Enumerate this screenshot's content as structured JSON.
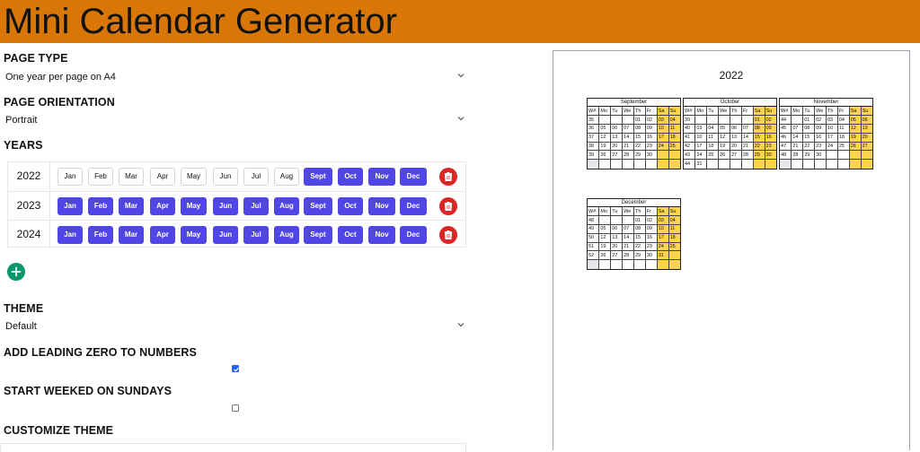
{
  "header": {
    "title": "Mini Calendar Generator"
  },
  "page_type": {
    "label": "PAGE TYPE",
    "value": "One year per page on A4"
  },
  "page_orientation": {
    "label": "PAGE ORIENTATION",
    "value": "Portrait"
  },
  "years": {
    "label": "YEARS",
    "rows": [
      {
        "year": "2022",
        "months": [
          {
            "label": "Jan",
            "on": false
          },
          {
            "label": "Feb",
            "on": false
          },
          {
            "label": "Mar",
            "on": false
          },
          {
            "label": "Apr",
            "on": false
          },
          {
            "label": "May",
            "on": false
          },
          {
            "label": "Jun",
            "on": false
          },
          {
            "label": "Jul",
            "on": false
          },
          {
            "label": "Aug",
            "on": false
          },
          {
            "label": "Sept",
            "on": true
          },
          {
            "label": "Oct",
            "on": true
          },
          {
            "label": "Nov",
            "on": true
          },
          {
            "label": "Dec",
            "on": true
          }
        ]
      },
      {
        "year": "2023",
        "months": [
          {
            "label": "Jan",
            "on": true
          },
          {
            "label": "Feb",
            "on": true
          },
          {
            "label": "Mar",
            "on": true
          },
          {
            "label": "Apr",
            "on": true
          },
          {
            "label": "May",
            "on": true
          },
          {
            "label": "Jun",
            "on": true
          },
          {
            "label": "Jul",
            "on": true
          },
          {
            "label": "Aug",
            "on": true
          },
          {
            "label": "Sept",
            "on": true
          },
          {
            "label": "Oct",
            "on": true
          },
          {
            "label": "Nov",
            "on": true
          },
          {
            "label": "Dec",
            "on": true
          }
        ]
      },
      {
        "year": "2024",
        "months": [
          {
            "label": "Jan",
            "on": true
          },
          {
            "label": "Feb",
            "on": true
          },
          {
            "label": "Mar",
            "on": true
          },
          {
            "label": "Apr",
            "on": true
          },
          {
            "label": "May",
            "on": true
          },
          {
            "label": "Jun",
            "on": true
          },
          {
            "label": "Jul",
            "on": true
          },
          {
            "label": "Aug",
            "on": true
          },
          {
            "label": "Sept",
            "on": true
          },
          {
            "label": "Oct",
            "on": true
          },
          {
            "label": "Nov",
            "on": true
          },
          {
            "label": "Dec",
            "on": true
          }
        ]
      }
    ]
  },
  "theme": {
    "label": "THEME",
    "value": "Default"
  },
  "leading_zero": {
    "label": "ADD LEADING ZERO TO NUMBERS",
    "checked": true
  },
  "start_sunday": {
    "label": "START WEEKED ON SUNDAYS",
    "checked": false
  },
  "customize_theme": {
    "label": "CUSTOMIZE THEME"
  },
  "preview": {
    "year": "2022",
    "header": [
      "W#",
      "Mo",
      "Tu",
      "We",
      "Th",
      "Fr",
      "Sa",
      "Su"
    ],
    "calendars": [
      {
        "name": "September",
        "weeks": [
          [
            "35",
            "",
            "",
            "",
            "01",
            "02",
            "03",
            "04"
          ],
          [
            "36",
            "05",
            "06",
            "07",
            "08",
            "09",
            "10",
            "11"
          ],
          [
            "37",
            "12",
            "13",
            "14",
            "15",
            "16",
            "17",
            "18"
          ],
          [
            "38",
            "19",
            "20",
            "21",
            "22",
            "23",
            "24",
            "25"
          ],
          [
            "39",
            "26",
            "27",
            "28",
            "29",
            "30",
            "",
            ""
          ],
          [
            "",
            "",
            "",
            "",
            "",
            "",
            "",
            ""
          ]
        ]
      },
      {
        "name": "October",
        "weeks": [
          [
            "39",
            "",
            "",
            "",
            "",
            "",
            "01",
            "02"
          ],
          [
            "40",
            "03",
            "04",
            "05",
            "06",
            "07",
            "08",
            "09"
          ],
          [
            "41",
            "10",
            "11",
            "12",
            "13",
            "14",
            "15",
            "16"
          ],
          [
            "42",
            "17",
            "18",
            "19",
            "20",
            "21",
            "22",
            "23"
          ],
          [
            "43",
            "24",
            "25",
            "26",
            "27",
            "28",
            "29",
            "30"
          ],
          [
            "44",
            "31",
            "",
            "",
            "",
            "",
            "",
            ""
          ]
        ]
      },
      {
        "name": "November",
        "weeks": [
          [
            "44",
            "",
            "01",
            "02",
            "03",
            "04",
            "05",
            "06"
          ],
          [
            "45",
            "07",
            "08",
            "09",
            "10",
            "11",
            "12",
            "13"
          ],
          [
            "46",
            "14",
            "15",
            "16",
            "17",
            "18",
            "19",
            "20"
          ],
          [
            "47",
            "21",
            "22",
            "23",
            "24",
            "25",
            "26",
            "27"
          ],
          [
            "48",
            "28",
            "29",
            "30",
            "",
            "",
            "",
            ""
          ],
          [
            "",
            "",
            "",
            "",
            "",
            "",
            "",
            ""
          ]
        ]
      },
      {
        "name": "December",
        "weeks": [
          [
            "48",
            "",
            "",
            "",
            "01",
            "02",
            "03",
            "04"
          ],
          [
            "49",
            "05",
            "06",
            "07",
            "08",
            "09",
            "10",
            "11"
          ],
          [
            "50",
            "12",
            "13",
            "14",
            "15",
            "16",
            "17",
            "18"
          ],
          [
            "51",
            "19",
            "20",
            "21",
            "22",
            "23",
            "24",
            "25"
          ],
          [
            "52",
            "26",
            "27",
            "28",
            "29",
            "30",
            "31",
            ""
          ],
          [
            "",
            "",
            "",
            "",
            "",
            "",
            "",
            ""
          ]
        ]
      }
    ]
  },
  "colors": {
    "header": "#d97706",
    "month_on": "#4f46e5",
    "delete": "#dc2626",
    "add": "#059669",
    "weekend": "#fcd34d"
  },
  "icons": {
    "chevron": "chevron-down-icon",
    "delete": "trash-icon",
    "add": "plus-icon"
  }
}
